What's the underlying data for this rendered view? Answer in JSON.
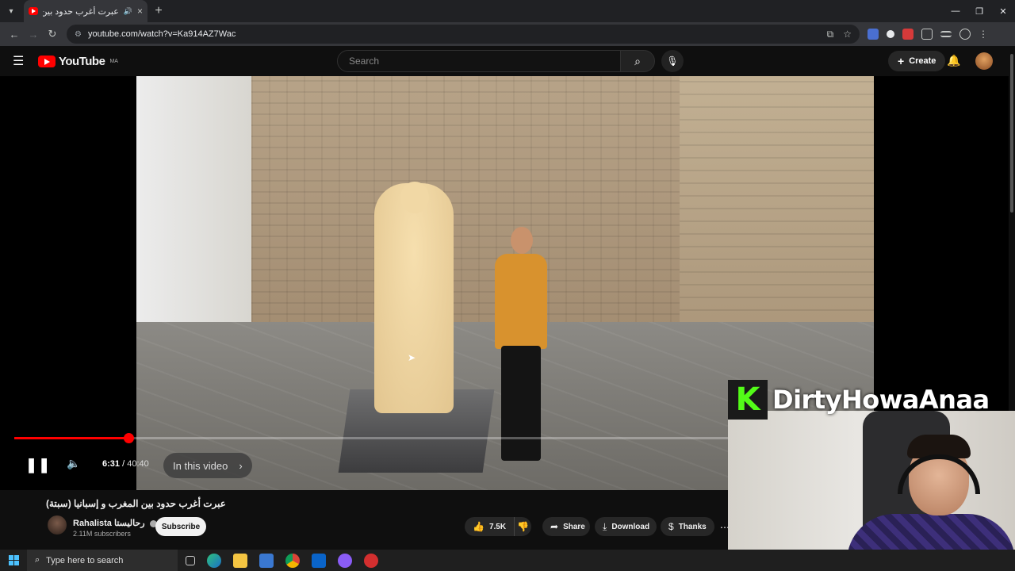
{
  "browser": {
    "tab_title": "عبرت أغرب حدود بين المغرب",
    "url": "youtube.com/watch?v=Ka914AZ7Wac"
  },
  "youtube": {
    "logo_text": "YouTube",
    "country_code": "MA",
    "search_placeholder": "Search",
    "create_label": "Create"
  },
  "player": {
    "current_time": "6:31",
    "duration": "40:40",
    "progress_fraction": 0.16,
    "chapter_label": "In this video"
  },
  "video": {
    "title": "عبرت أغرب حدود بين المغرب و إسبانيا (سبتة)",
    "channel_name": "Rahalista رحاليستا",
    "subscribers": "2.11M subscribers",
    "subscribe_label": "Subscribe",
    "like_count": "7.5K",
    "share_label": "Share",
    "download_label": "Download",
    "thanks_label": "Thanks"
  },
  "overlay": {
    "streamer_name": "DirtyHowaAnaa",
    "platform_letter": "K"
  },
  "taskbar": {
    "search_placeholder": "Type here to search"
  },
  "colors": {
    "yt_red": "#ff0000",
    "kick_green": "#53fc18",
    "background": "#0f0f0f"
  }
}
